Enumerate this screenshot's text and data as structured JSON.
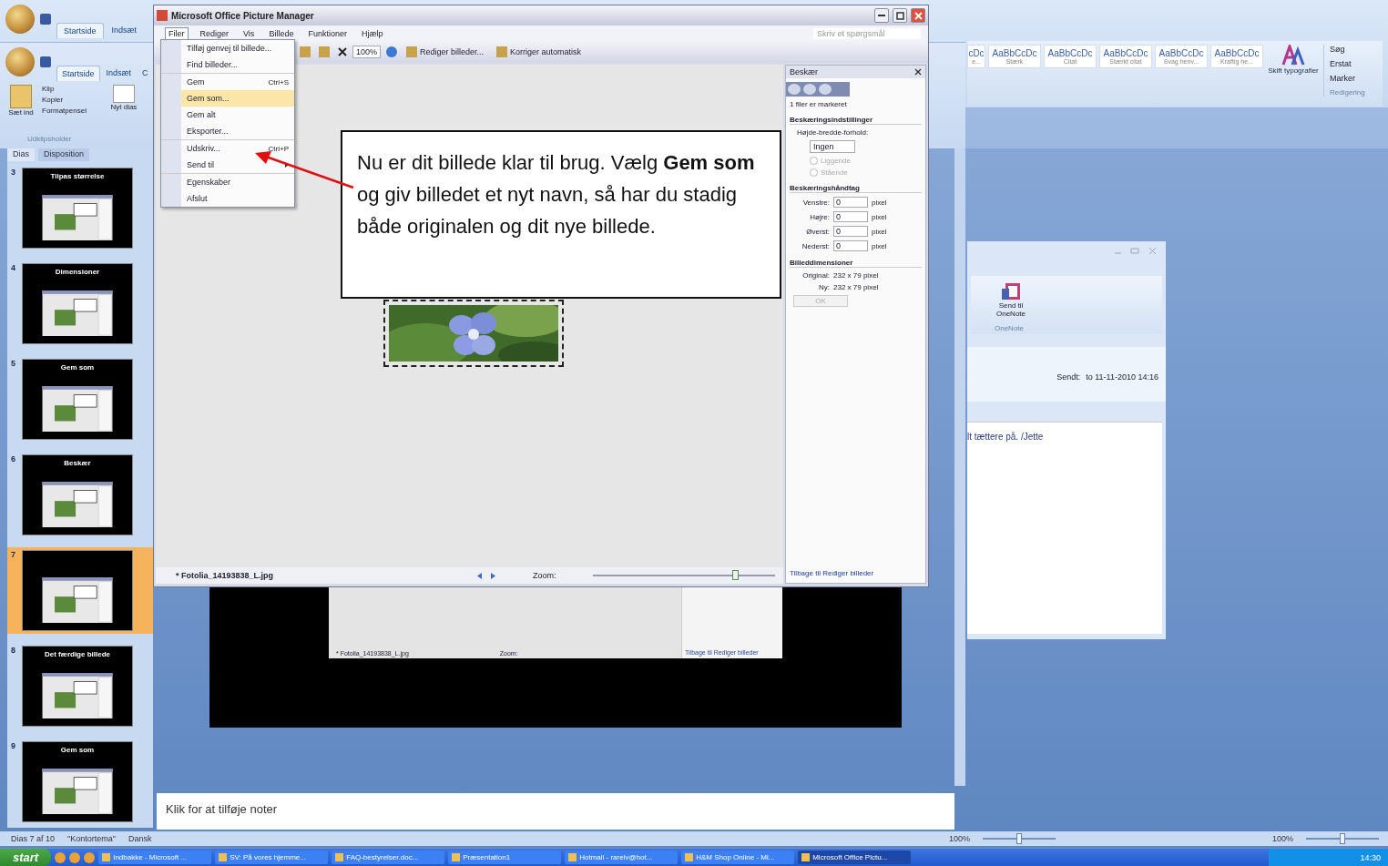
{
  "word_window": {
    "tabs": [
      {
        "label": "Startside",
        "selected": true
      },
      {
        "label": "Indsæt",
        "selected": false
      }
    ],
    "styles": [
      {
        "sample": "cDc",
        "name": "e..."
      },
      {
        "sample": "AaBbCcDc",
        "name": "Stærk"
      },
      {
        "sample": "AaBbCcDc",
        "name": "Citat"
      },
      {
        "sample": "AaBbCcDc",
        "name": "Stærkt citat"
      },
      {
        "sample": "AaBbCcDc",
        "name": "Svag henv..."
      },
      {
        "sample": "AaBbCcDc",
        "name": "Kraftig he..."
      }
    ],
    "change_styles": "Skift typografier",
    "editing": [
      "Søg",
      "Erstat",
      "Marker"
    ],
    "editing_group": "Redigering"
  },
  "powerpoint": {
    "tabs": [
      {
        "label": "Startside",
        "selected": true
      },
      {
        "label": "Indsæt",
        "selected": false
      },
      {
        "label": "C",
        "selected": false
      }
    ],
    "paste": "Sæt ind",
    "clipboard_items": [
      "Klip",
      "Kopier",
      "Formatpensel"
    ],
    "clipboard_group": "Udklipsholder",
    "new_slide": "Nyt dias",
    "pane_tabs": [
      {
        "label": "Dias",
        "selected": true
      },
      {
        "label": "Disposition",
        "selected": false
      }
    ],
    "slides": [
      {
        "number": "3",
        "title": "Tilpas størrelse",
        "selected": false
      },
      {
        "number": "4",
        "title": "Dimensioner",
        "selected": false
      },
      {
        "number": "5",
        "title": "Gem som",
        "selected": false
      },
      {
        "number": "6",
        "title": "Beskær",
        "selected": false
      },
      {
        "number": "7",
        "selected": true
      },
      {
        "number": "8",
        "title": "Det færdige billede",
        "selected": false
      },
      {
        "number": "9",
        "title": "Gem som",
        "selected": false
      }
    ],
    "slide_preview": {
      "filename": "* Fotolia_14193838_L.jpg",
      "zoom_label": "Zoom:",
      "link": "Tilbage til Rediger billeder"
    },
    "notes_placeholder": "Klik for at tilføje noter",
    "status": [
      "Dias 7 af 10",
      "\"Kontortema\"",
      "Dansk"
    ],
    "zoom_controls": [
      {
        "value": "100%",
        "level": 0.5
      },
      {
        "value": "100%",
        "level": 0.5
      }
    ]
  },
  "outlook_window": {
    "button": "Send til OneNote",
    "group": "OneNote",
    "sent_label": "Sendt:",
    "sent_value": "to 11-11-2010 14:16",
    "body": "lt tættere på. /Jette"
  },
  "picture_manager": {
    "title": "Microsoft Office Picture Manager",
    "menu": [
      {
        "label": "Filer",
        "selected": true
      },
      {
        "label": "Rediger",
        "selected": false
      },
      {
        "label": "Vis",
        "selected": false
      },
      {
        "label": "Billede",
        "selected": false
      },
      {
        "label": "Funktioner",
        "selected": false
      },
      {
        "label": "Hjælp",
        "selected": false
      }
    ],
    "help_placeholder": "Skriv et spørgsmål",
    "zoom_value": "100%",
    "edit_button": "Rediger billeder...",
    "auto_button": "Korriger automatisk",
    "file_menu": [
      {
        "label": "Tilføj genvej til billede...",
        "selected": false,
        "submenu": false,
        "group_start": false
      },
      {
        "label": "Find billeder...",
        "selected": false,
        "submenu": false,
        "group_start": false
      },
      {
        "label": "Gem",
        "shortcut": "Ctrl+S",
        "selected": false,
        "submenu": false,
        "group_start": true
      },
      {
        "label": "Gem som...",
        "selected": true,
        "submenu": false,
        "group_start": false
      },
      {
        "label": "Gem alt",
        "selected": false,
        "submenu": false,
        "group_start": false
      },
      {
        "label": "Eksporter...",
        "selected": false,
        "submenu": false,
        "group_start": false
      },
      {
        "label": "Udskriv...",
        "shortcut": "Ctrl+P",
        "selected": false,
        "submenu": false,
        "group_start": true
      },
      {
        "label": "Send til",
        "selected": false,
        "submenu": true,
        "group_start": false
      },
      {
        "label": "Egenskaber",
        "selected": false,
        "submenu": false,
        "group_start": true
      },
      {
        "label": "Afslut",
        "selected": false,
        "submenu": false,
        "group_start": false
      }
    ],
    "filename": "* Fotolia_14193838_L.jpg",
    "zoom_label": "Zoom:",
    "zoom": {
      "level": 0.78
    },
    "task_pane": {
      "title": "Beskær",
      "info": "1 filer er markeret",
      "crop_settings": "Beskæringsindstillinger",
      "ratio_label": "Højde-bredde-forhold:",
      "ratio_value": "Ingen",
      "orientations": [
        {
          "label": "Liggende",
          "selected": false,
          "disabled": true
        },
        {
          "label": "Stående",
          "selected": false,
          "disabled": true
        }
      ],
      "handles_heading": "Beskæringshåndtag",
      "handles": [
        {
          "label": "Venstre:",
          "value": "0",
          "unit": "pixel"
        },
        {
          "label": "Højre:",
          "value": "0",
          "unit": "pixel"
        },
        {
          "label": "Øverst:",
          "value": "0",
          "unit": "pixel"
        },
        {
          "label": "Nederst:",
          "value": "0",
          "unit": "pixel"
        }
      ],
      "dims_heading": "Billeddimensioner",
      "dims": [
        {
          "label": "Original:",
          "value": "232 x 79 pixel"
        },
        {
          "label": "Ny:",
          "value": "232 x 79 pixel"
        }
      ],
      "ok": "OK",
      "link": "Tilbage til Rediger billeder"
    }
  },
  "callout": {
    "text": "Nu er dit billede klar til brug. Vælg **Gem som** og giv billedet et nyt navn, så har du stadig både originalen og dit nye billede."
  },
  "taskbar": {
    "start": "start",
    "tasks": [
      {
        "label": "Indbakke - Microsoft ...",
        "selected": false
      },
      {
        "label": "SV: På vores hjemme...",
        "selected": false
      },
      {
        "label": "FAQ-bestyrelser.doc...",
        "selected": false
      },
      {
        "label": "Præsentation1",
        "selected": false
      },
      {
        "label": "Hotmail - rarelv@hot...",
        "selected": false
      },
      {
        "label": "H&M Shop Online - Mi...",
        "selected": false
      },
      {
        "label": "Microsoft Office Pictu...",
        "selected": true
      }
    ],
    "clock": "14:30"
  }
}
